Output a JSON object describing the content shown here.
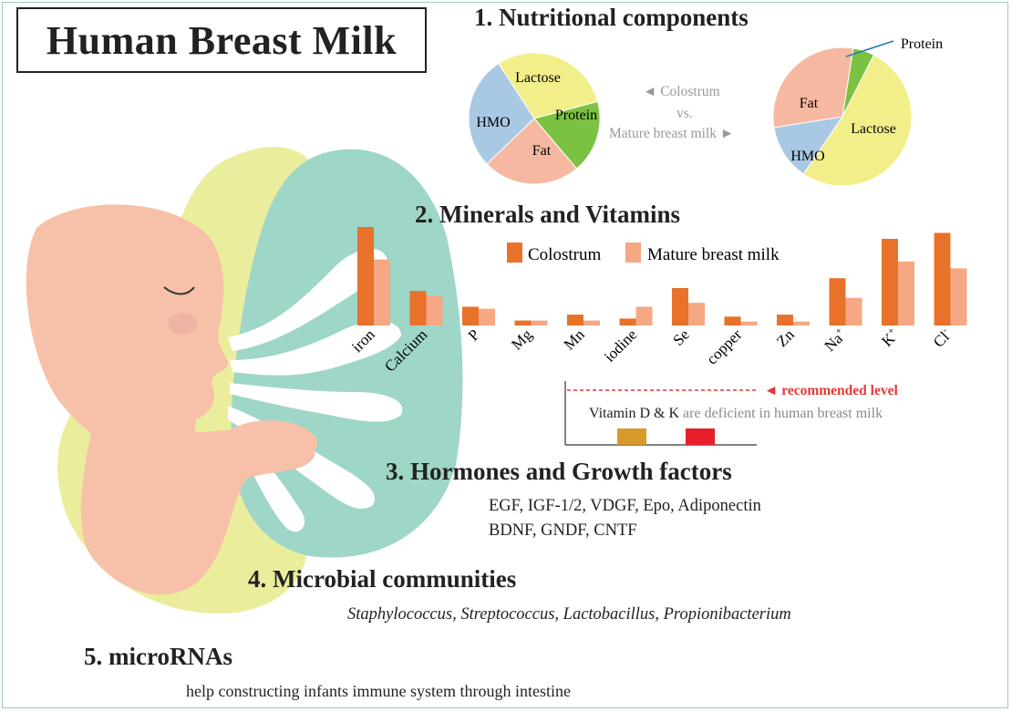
{
  "title": "Human Breast Milk",
  "sections": {
    "nutritional": {
      "heading": "1. Nutritional components",
      "colostrum_label": "◄ Colostrum",
      "vs_label": "vs.",
      "mature_label": "Mature breast milk ►",
      "pie_colostrum": [
        {
          "label": "Lactose",
          "value": 30,
          "color": "#f2ef8a"
        },
        {
          "label": "Protein",
          "value": 18,
          "color": "#7cc242"
        },
        {
          "label": "Fat",
          "value": 24,
          "color": "#f6b8a0"
        },
        {
          "label": "HMO",
          "value": 28,
          "color": "#a9c8e4"
        }
      ],
      "pie_mature": [
        {
          "label": "Protein",
          "value": 5,
          "color": "#7cc242"
        },
        {
          "label": "Lactose",
          "value": 52,
          "color": "#f2ef8a"
        },
        {
          "label": "HMO",
          "value": 13,
          "color": "#a9c8e4"
        },
        {
          "label": "Fat",
          "value": 30,
          "color": "#f6b8a0"
        }
      ]
    },
    "minerals": {
      "heading": "2. Minerals and Vitamins",
      "recommended_label": "◄ recommended level",
      "vitamin_bold": "Vitamin D & K",
      "vitamin_rest": " are deficient in human breast milk",
      "vitamin_colors": {
        "vitamin_d": "#d79a2a",
        "vitamin_k": "#e61e2a"
      }
    },
    "hormones": {
      "heading": "3. Hormones and Growth factors",
      "line1": "EGF, IGF-1/2, VDGF, Epo, Adiponectin",
      "line2": "BDNF, GNDF, CNTF"
    },
    "microbial": {
      "heading": "4. Microbial communities",
      "species": "Staphylococcus, Streptococcus, Lactobacillus, Propionibacterium"
    },
    "micrornas": {
      "heading": "5. microRNAs",
      "description": "help constructing infants immune system through intestine"
    }
  },
  "chart_data": {
    "type": "bar",
    "categories": [
      "iron",
      "Calcium",
      "P",
      "Mg",
      "Mn",
      "iodine",
      "Se",
      "copper",
      "Zn",
      "Na+",
      "K+",
      "Cl-"
    ],
    "series": [
      {
        "name": "Colostrum",
        "color": "#e8722a",
        "values": [
          100,
          35,
          19,
          5,
          11,
          7,
          38,
          9,
          11,
          48,
          88,
          94
        ]
      },
      {
        "name": "Mature breast milk",
        "color": "#f5a883",
        "values": [
          67,
          30,
          17,
          5,
          5,
          19,
          23,
          4,
          4,
          28,
          65,
          58
        ]
      }
    ],
    "ylim": [
      0,
      100
    ]
  }
}
